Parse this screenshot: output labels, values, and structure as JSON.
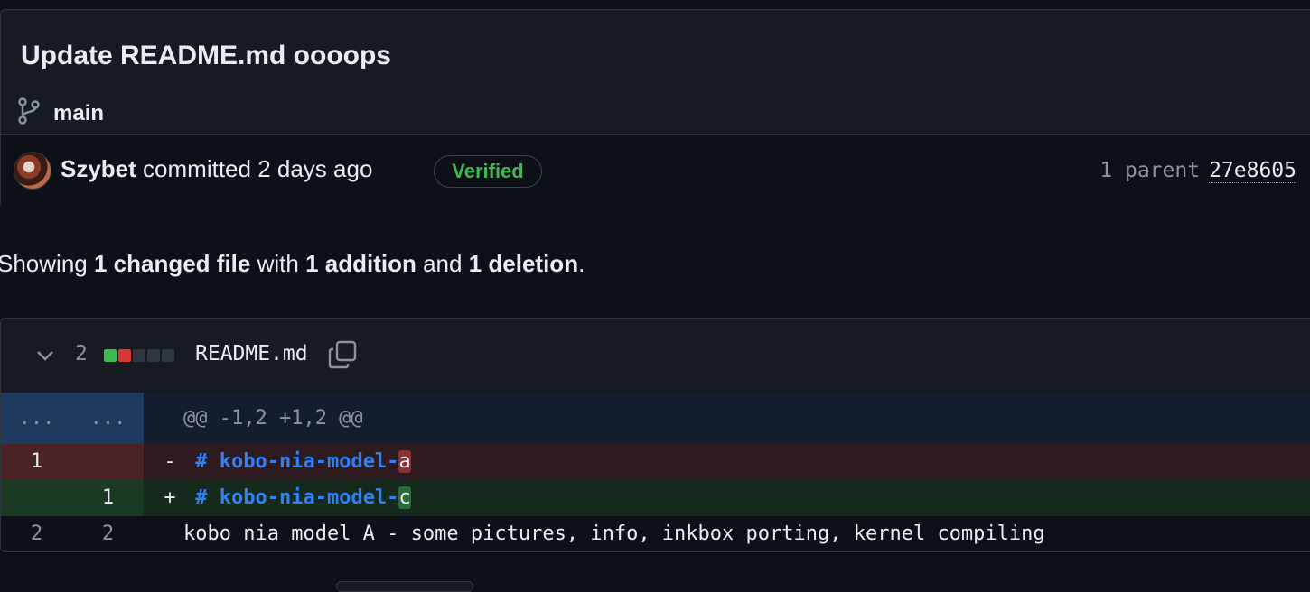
{
  "commit": {
    "title": "Update README.md oooops",
    "branch": "main",
    "author": "Szybet",
    "action_text": "committed 2 days ago",
    "verified_label": "Verified",
    "parent_label": "1 parent",
    "parent_sha": "27e8605"
  },
  "summary": {
    "prefix": "Showing",
    "files": "1 changed file",
    "with": "with",
    "additions": "1 addition",
    "and": "and",
    "deletions": "1 deletion",
    "suffix": "."
  },
  "file": {
    "change_count": "2",
    "name": "README.md",
    "blocks": [
      "#3fb950",
      "#da3633",
      "#30363d",
      "#30363d",
      "#30363d"
    ]
  },
  "diff": {
    "hunk": {
      "left": "...",
      "right": "...",
      "text": "@@ -1,2 +1,2 @@"
    },
    "lines": [
      {
        "type": "del",
        "left": "1",
        "right": "",
        "sign": "-",
        "hash": "#",
        "text": "kobo-nia-model-",
        "changed": "a"
      },
      {
        "type": "add",
        "left": "",
        "right": "1",
        "sign": "+",
        "hash": "#",
        "text": "kobo-nia-model-",
        "changed": "c"
      },
      {
        "type": "ctx",
        "left": "2",
        "right": "2",
        "text": "kobo nia model A - some pictures, info, inkbox porting, kernel compiling"
      }
    ]
  },
  "colors": {
    "background": "#0d1117",
    "verified": "#3fb950",
    "link_blue": "#2f81f7"
  }
}
